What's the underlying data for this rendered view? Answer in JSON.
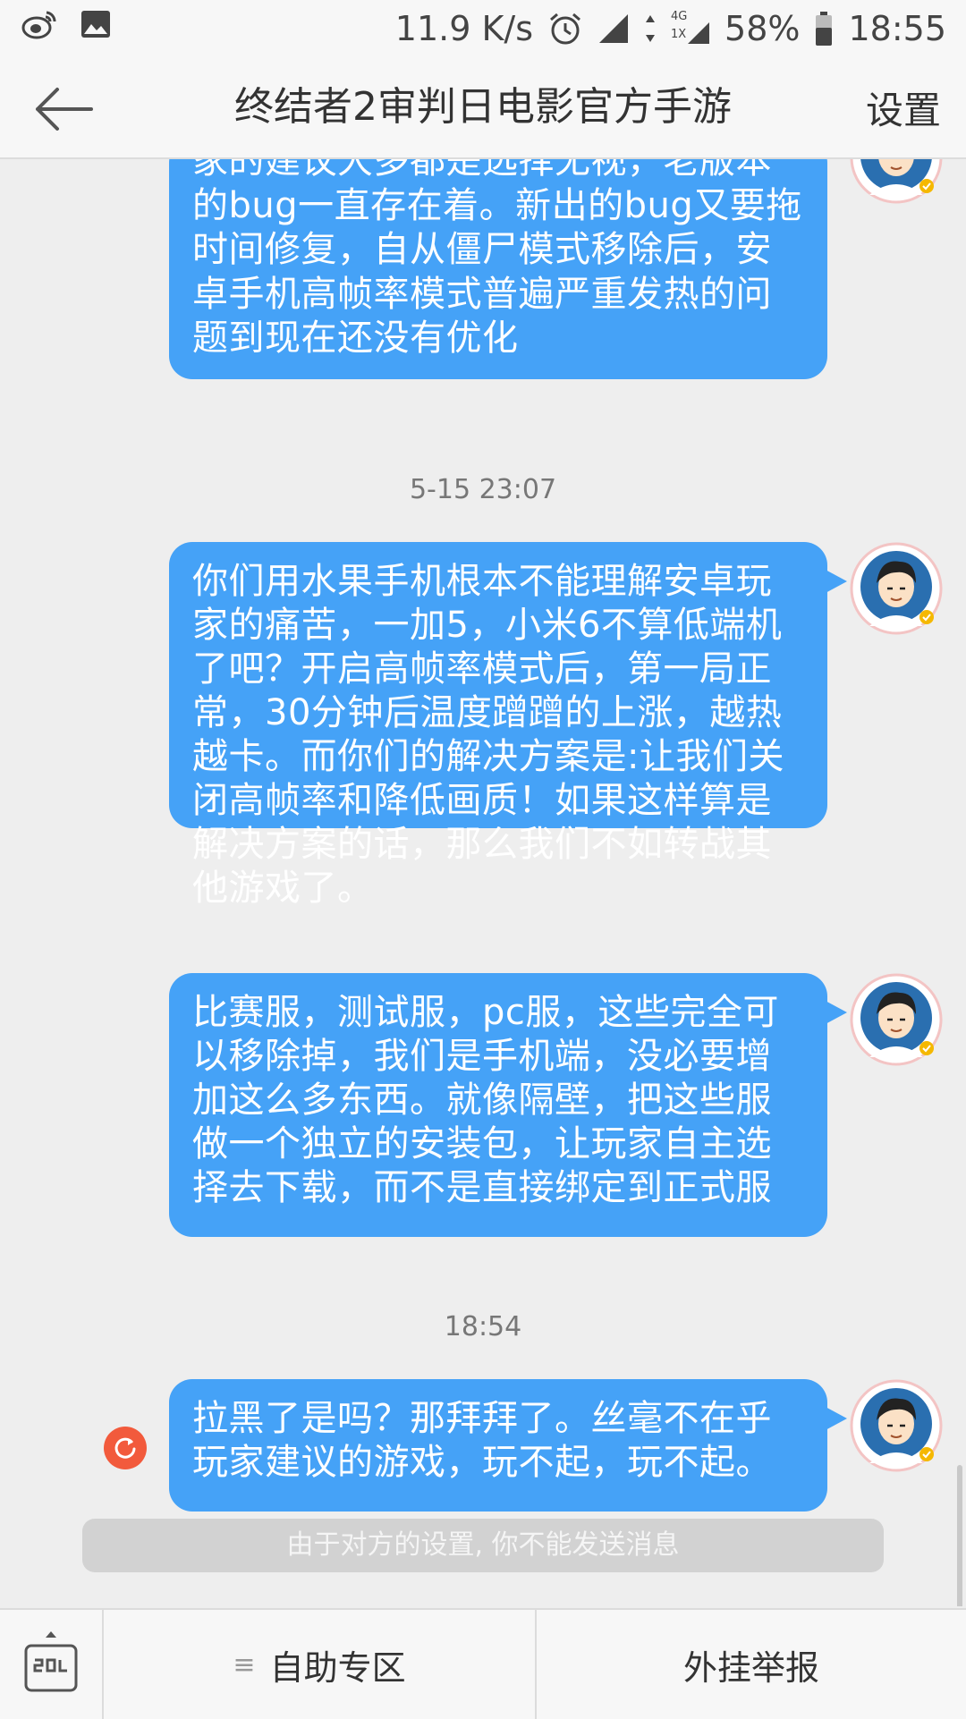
{
  "status_bar": {
    "network_speed": "11.9 K/s",
    "network_type_top": "4G",
    "network_type_bottom": "1X",
    "battery": "58%",
    "time": "18:55",
    "icons": [
      "weibo-icon",
      "image-icon",
      "alarm-icon",
      "signal-icon",
      "battery-icon"
    ]
  },
  "header": {
    "title": "终结者2审判日电影官方手游",
    "settings_label": "设置",
    "back_icon": "back-arrow-icon"
  },
  "messages": [
    {
      "text": "家的建议大多都是选择无视，老版本的bug一直存在着。新出的bug又要拖时间修复，自从僵尸模式移除后，安卓手机高帧率模式普遍严重发热的问题到现在还没有优化"
    },
    {
      "timestamp": "5-15 23:07",
      "text": "你们用水果手机根本不能理解安卓玩家的痛苦，一加5，小米6不算低端机了吧？开启高帧率模式后，第一局正常，30分钟后温度蹭蹭的上涨，越热越卡。而你们的解决方案是:让我们关闭高帧率和降低画质！如果这样算是解决方案的话，那么我们不如转战其他游戏了。"
    },
    {
      "text": "比赛服，测试服，pc服，这些完全可以移除掉，我们是手机端，没必要增加这么多东西。就像隔壁，把这些服做一个独立的安装包，让玩家自主选择去下载，而不是直接绑定到正式服"
    },
    {
      "timestamp": "18:54",
      "text": "拉黑了是吗？那拜拜了。丝毫不在乎玩家建议的游戏，玩不起，玩不起。",
      "failed": true
    }
  ],
  "notice": "由于对方的设置, 你不能发送消息",
  "bottom_bar": {
    "self_service_label": "自助专区",
    "report_label": "外挂举报"
  },
  "colors": {
    "bubble": "#45a2f7",
    "retry": "#f25a3c"
  }
}
